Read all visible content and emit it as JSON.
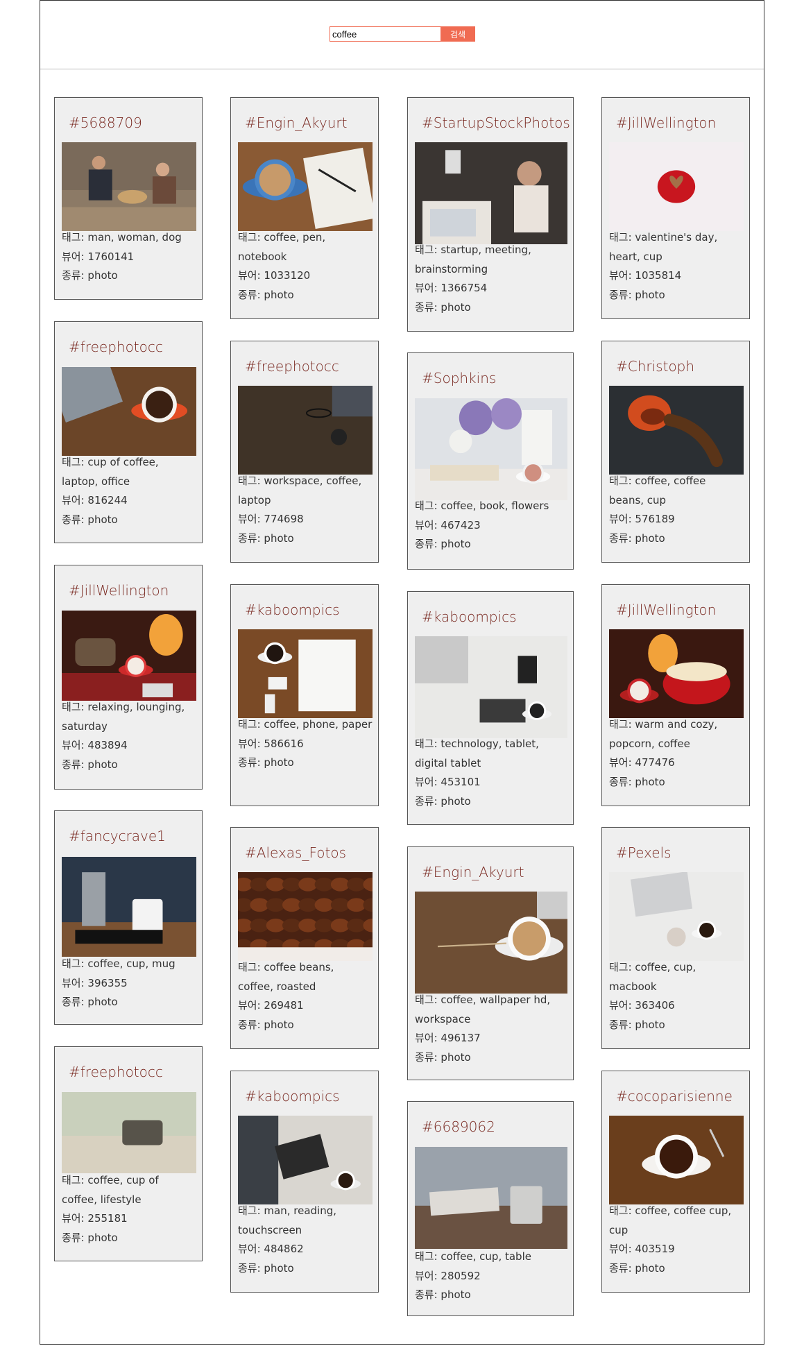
{
  "search": {
    "value": "coffee",
    "button_label": "검색"
  },
  "labels": {
    "tags": "태그: ",
    "views": "뷰어: ",
    "type": "종류: "
  },
  "cards": [
    {
      "author": "#5688709",
      "tags": "man, woman, dog",
      "views": "1760141",
      "type": "photo",
      "img": "people"
    },
    {
      "author": "#Engin_Akyurt",
      "tags": "coffee, pen, notebook",
      "views": "1033120",
      "type": "photo",
      "img": "cup-notebook"
    },
    {
      "author": "#StartupStockPhotos",
      "tags": "startup, meeting, brainstorming",
      "views": "1366754",
      "type": "photo",
      "img": "meeting"
    },
    {
      "author": "#JillWellington",
      "tags": "valentine's day, heart, cup",
      "views": "1035814",
      "type": "photo",
      "img": "heart-snow"
    },
    {
      "author": "#freephotocc",
      "tags": "cup of coffee, laptop, office",
      "views": "816244",
      "type": "photo",
      "img": "laptop-cup"
    },
    {
      "author": "#freephotocc",
      "tags": "workspace, coffee, laptop",
      "views": "774698",
      "type": "photo",
      "img": "workspace"
    },
    {
      "author": "#Sophkins",
      "tags": "coffee, book, flowers",
      "views": "467423",
      "type": "photo",
      "img": "flowers"
    },
    {
      "author": "#Christoph",
      "tags": "coffee, coffee beans, cup",
      "views": "576189",
      "type": "photo",
      "img": "beans-cup"
    },
    {
      "author": "#JillWellington",
      "tags": "relaxing, lounging, saturday",
      "views": "483894",
      "type": "photo",
      "img": "fireplace-feet"
    },
    {
      "author": "#kaboompics",
      "tags": "coffee, phone, paper",
      "views": "586616",
      "type": "photo",
      "img": "desk-paper"
    },
    {
      "author": "#kaboompics",
      "tags": "technology, tablet, digital tablet",
      "views": "453101",
      "type": "photo",
      "img": "white-desk"
    },
    {
      "author": "#JillWellington",
      "tags": "warm and cozy, popcorn, coffee",
      "views": "477476",
      "type": "photo",
      "img": "popcorn"
    },
    {
      "author": "#fancycrave1",
      "tags": "coffee, cup, mug",
      "views": "396355",
      "type": "photo",
      "img": "mug"
    },
    {
      "author": "#Alexas_Fotos",
      "tags": "coffee beans, coffee, roasted",
      "views": "269481",
      "type": "photo",
      "img": "beans"
    },
    {
      "author": "#Engin_Akyurt",
      "tags": "coffee, wallpaper hd, workspace",
      "views": "496137",
      "type": "photo",
      "img": "latte-wood"
    },
    {
      "author": "#Pexels",
      "tags": "coffee, cup, macbook",
      "views": "363406",
      "type": "photo",
      "img": "bed-laptop"
    },
    {
      "author": "#freephotocc",
      "tags": "coffee, cup of coffee, lifestyle",
      "views": "255181",
      "type": "photo",
      "img": "book-cup"
    },
    {
      "author": "#kaboompics",
      "tags": "man, reading, touchscreen",
      "views": "484862",
      "type": "photo",
      "img": "tablet-man"
    },
    {
      "author": "#6689062",
      "tags": "coffee, cup, table",
      "views": "280592",
      "type": "photo",
      "img": "cup-table"
    },
    {
      "author": "#cocoparisienne",
      "tags": "coffee, coffee cup, cup",
      "views": "403519",
      "type": "photo",
      "img": "espresso"
    }
  ]
}
